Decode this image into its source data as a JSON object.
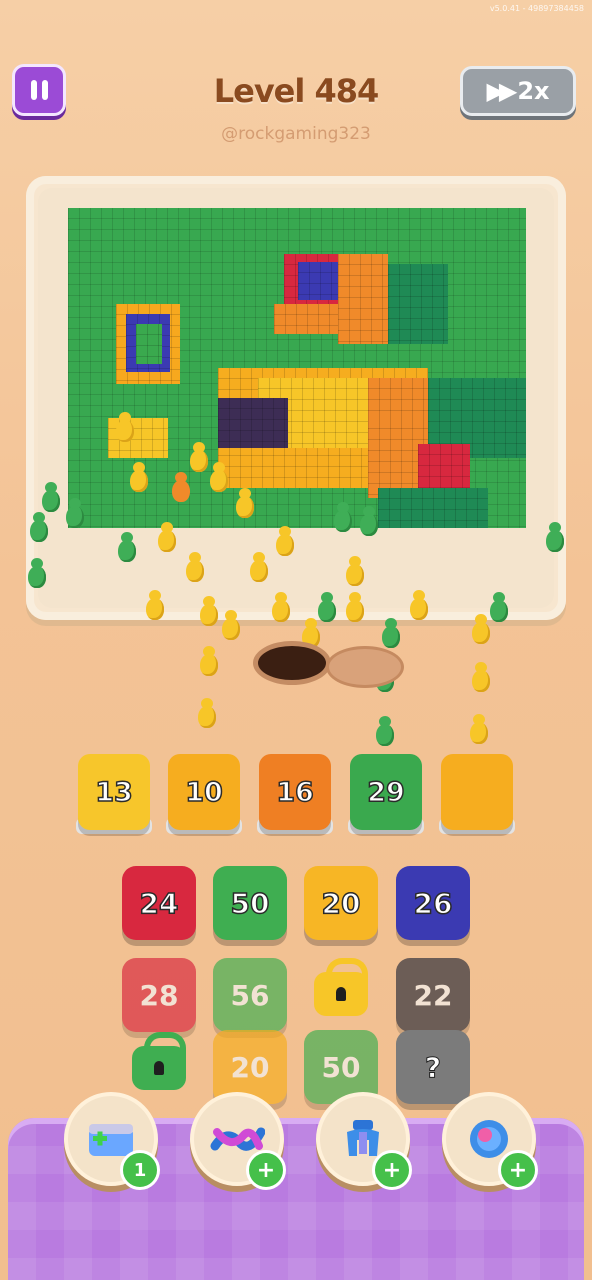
{
  "hud": {
    "version": "v5.0.41 - 49897384458",
    "level_title": "Level 484",
    "username": "@rockgaming323",
    "speed_label": "2x"
  },
  "queue_slots": [
    {
      "value": "13",
      "color": "#f7c62b"
    },
    {
      "value": "10",
      "color": "#f6ad1f"
    },
    {
      "value": "16",
      "color": "#ef7f23"
    },
    {
      "value": "29",
      "color": "#3aa94e"
    },
    {
      "value": "",
      "color": "#f6ad1f"
    }
  ],
  "grid": {
    "row1": [
      {
        "value": "24",
        "color": "#d8283f"
      },
      {
        "value": "50",
        "color": "#3fae51"
      },
      {
        "value": "20",
        "color": "#f7b625"
      },
      {
        "value": "26",
        "color": "#3b3ab2"
      }
    ],
    "row2": [
      {
        "value": "28",
        "color": "#d8283f"
      },
      {
        "value": "56",
        "color": "#3fae51"
      },
      {
        "value": "",
        "color": "#f7c628",
        "locked": true
      },
      {
        "value": "22",
        "color": "#2e2f3b"
      }
    ],
    "row3": [
      {
        "value": "",
        "color": "#3fae51",
        "locked": true
      },
      {
        "value": "20",
        "color": "#f6ad1f"
      },
      {
        "value": "50",
        "color": "#3fae51"
      },
      {
        "value": "?",
        "color": "#7b7b7b"
      }
    ]
  },
  "powerups": [
    {
      "name": "add-slot",
      "badge": "1"
    },
    {
      "name": "shuffle",
      "badge": "+"
    },
    {
      "name": "magnet",
      "badge": "+"
    },
    {
      "name": "ring",
      "badge": "+"
    }
  ]
}
